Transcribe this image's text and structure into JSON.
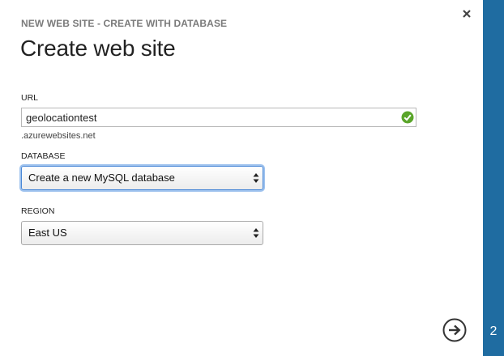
{
  "dialog": {
    "subtitle": "NEW WEB SITE - CREATE WITH DATABASE",
    "title": "Create web site"
  },
  "url_field": {
    "label": "URL",
    "value": "geolocationtest",
    "suffix": ".azurewebsites.net",
    "status_icon": "check-circle-icon",
    "status_color": "#5aa52a"
  },
  "database_field": {
    "label": "DATABASE",
    "selected": "Create a new MySQL database"
  },
  "region_field": {
    "label": "REGION",
    "selected": "East US"
  },
  "navigation": {
    "close_icon": "close-icon",
    "next_icon": "arrow-right-circle-icon",
    "step": "2"
  },
  "colors": {
    "sidebar": "#1f6ca1",
    "focus_ring": "#9ec2ee"
  }
}
